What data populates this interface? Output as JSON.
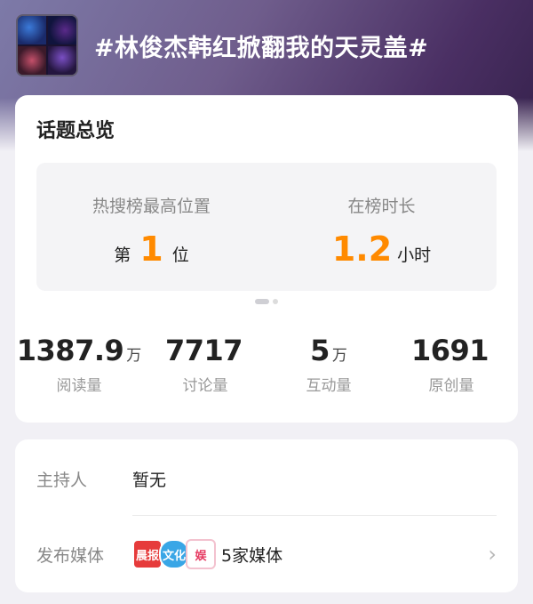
{
  "topic": {
    "title": "#林俊杰韩红掀翻我的天灵盖#"
  },
  "overview": {
    "heading": "话题总览",
    "hot_rank": {
      "label": "热搜榜最高位置",
      "prefix": "第",
      "value": "1",
      "suffix": "位"
    },
    "duration": {
      "label": "在榜时长",
      "value": "1.2",
      "unit": "小时"
    },
    "stats": [
      {
        "value": "1387.9",
        "unit": "万",
        "label": "阅读量"
      },
      {
        "value": "7717",
        "unit": "",
        "label": "讨论量"
      },
      {
        "value": "5",
        "unit": "万",
        "label": "互动量"
      },
      {
        "value": "1691",
        "unit": "",
        "label": "原创量"
      }
    ]
  },
  "info": {
    "host_label": "主持人",
    "host_value": "暂无",
    "media_label": "发布媒体",
    "media_value": "5家媒体",
    "media_logos": [
      "晨报",
      "文化",
      "娱"
    ]
  },
  "colors": {
    "accent": "#ff8a00"
  }
}
